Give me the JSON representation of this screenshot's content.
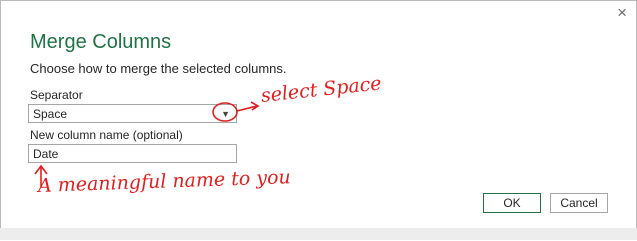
{
  "dialog": {
    "title": "Merge Columns",
    "subtitle": "Choose how to merge the selected columns.",
    "close_symbol": "×",
    "separator": {
      "label": "Separator",
      "value": "Space"
    },
    "new_column": {
      "label": "New column name (optional)",
      "value": "Date"
    },
    "ok_label": "OK",
    "cancel_label": "Cancel"
  },
  "annotations": {
    "select_note": "select Space",
    "name_note": "A meaningful name to you"
  },
  "colors": {
    "accent": "#217346",
    "annotation": "#e02020"
  }
}
